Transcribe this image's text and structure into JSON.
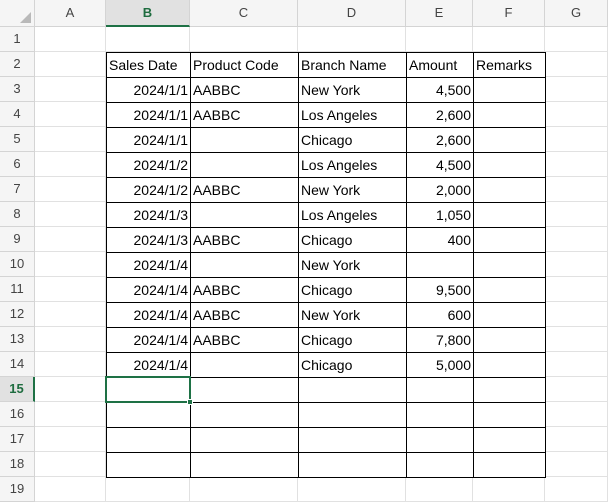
{
  "columns": [
    "A",
    "B",
    "C",
    "D",
    "E",
    "F",
    "G"
  ],
  "rows": [
    "1",
    "2",
    "3",
    "4",
    "5",
    "6",
    "7",
    "8",
    "9",
    "10",
    "11",
    "12",
    "13",
    "14",
    "15",
    "16",
    "17",
    "18",
    "19"
  ],
  "active_cell": {
    "col": "B",
    "row": "15"
  },
  "accent_color": "#1e7145",
  "table": {
    "headers": [
      "Sales Date",
      "Product Code",
      "Branch Name",
      "Amount",
      "Remarks"
    ],
    "rows": [
      [
        "2024/1/1",
        "AABBC",
        "New York",
        "4,500",
        ""
      ],
      [
        "2024/1/1",
        "AABBC",
        "Los Angeles",
        "2,600",
        ""
      ],
      [
        "2024/1/1",
        "",
        "Chicago",
        "2,600",
        ""
      ],
      [
        "2024/1/2",
        "",
        "Los Angeles",
        "4,500",
        ""
      ],
      [
        "2024/1/2",
        "AABBC",
        "New York",
        "2,000",
        ""
      ],
      [
        "2024/1/3",
        "",
        "Los Angeles",
        "1,050",
        ""
      ],
      [
        "2024/1/3",
        "AABBC",
        "Chicago",
        "400",
        ""
      ],
      [
        "2024/1/4",
        "",
        "New York",
        "",
        ""
      ],
      [
        "2024/1/4",
        "AABBC",
        "Chicago",
        "9,500",
        ""
      ],
      [
        "2024/1/4",
        "AABBC",
        "New York",
        "600",
        ""
      ],
      [
        "2024/1/4",
        "AABBC",
        "Chicago",
        "7,800",
        ""
      ],
      [
        "2024/1/4",
        "",
        "Chicago",
        "5,000",
        ""
      ],
      [
        "",
        "",
        "",
        "",
        ""
      ],
      [
        "",
        "",
        "",
        "",
        ""
      ],
      [
        "",
        "",
        "",
        "",
        ""
      ],
      [
        "",
        "",
        "",
        "",
        ""
      ]
    ]
  }
}
